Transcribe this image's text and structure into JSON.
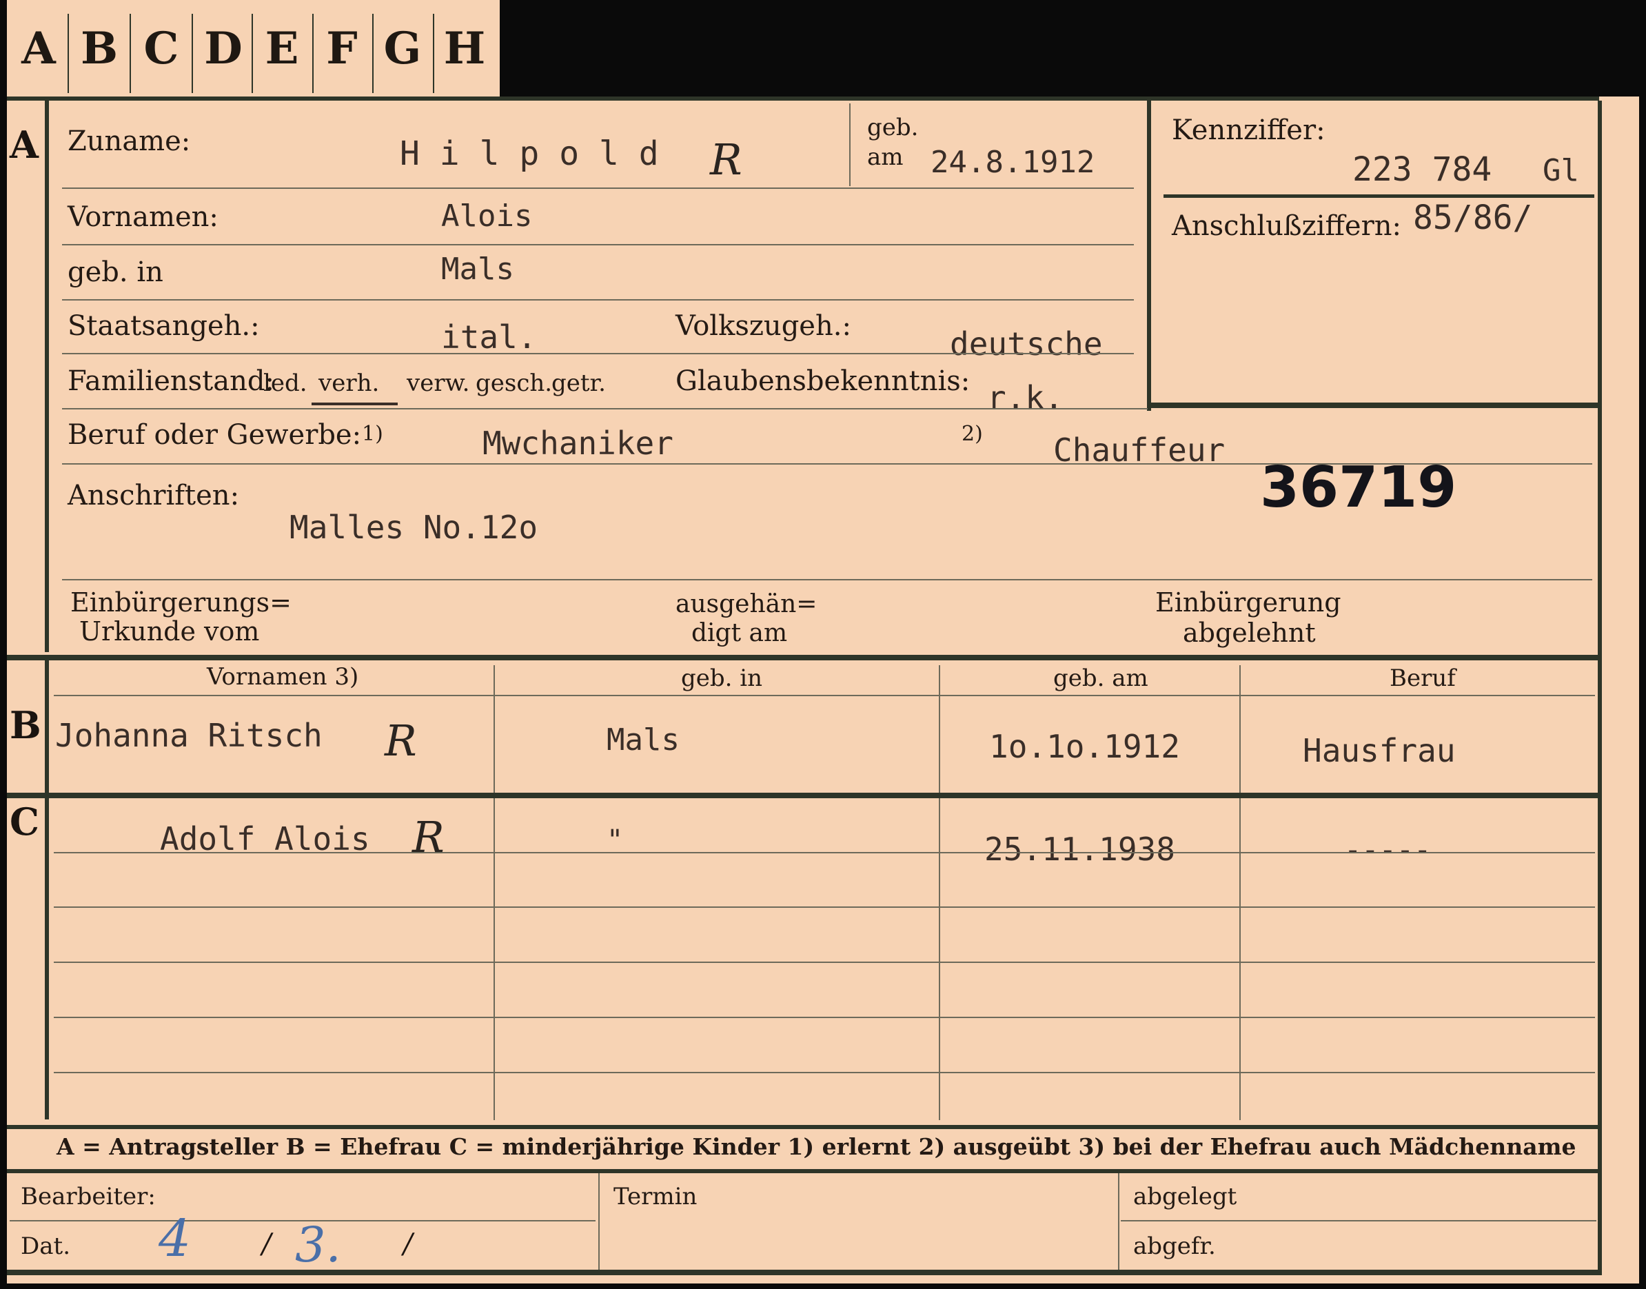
{
  "tabs": [
    "A",
    "B",
    "C",
    "D",
    "E",
    "F",
    "G",
    "H"
  ],
  "sections": {
    "a": "A",
    "b": "B",
    "c": "C"
  },
  "applicant": {
    "surname_label": "Zuname:",
    "surname": "H i l p o l d",
    "geb_label": "geb.",
    "am_label": "am",
    "birth_date": "24.8.1912",
    "first_names_label": "Vornamen:",
    "first_names": "Alois",
    "birthplace_label": "geb. in",
    "birthplace": "Mals",
    "citizenship_label": "Staatsangeh.:",
    "citizenship": "ital.",
    "ethnicity_label": "Volkszugeh.:",
    "ethnicity": "deutsche",
    "marital_label": "Familienstand:",
    "marital_options": [
      "led.",
      "verh.",
      "verw.",
      "gesch.",
      "getr."
    ],
    "religion_label": "Glaubensbekenntnis:",
    "religion": "r.k.",
    "profession_label": "Beruf oder Gewerbe:",
    "fn1": "1)",
    "fn2": "2)",
    "profession_learned": "Mwchaniker",
    "profession_practiced": "Chauffeur",
    "address_label": "Anschriften:",
    "address": "Malles No.12o",
    "stamp_number": "36719",
    "naturalization_label_1": "Einbürgerungs=",
    "naturalization_label_2": "Urkunde vom",
    "handed_label_1": "ausgehän=",
    "handed_label_2": "digt am",
    "rejected_label_1": "Einbürgerung",
    "rejected_label_2": "abgelehnt"
  },
  "id_box": {
    "label": "Kennziffer:",
    "number": "223 784",
    "suffix": "Gl",
    "linked_label": "Anschlußziffern:",
    "linked": "85/86/"
  },
  "family_table": {
    "headers": [
      "Vornamen 3)",
      "geb. in",
      "geb. am",
      "Beruf"
    ],
    "spouse": {
      "name": "Johanna Ritsch",
      "birthplace": "Mals",
      "birth_date": "1o.1o.1912",
      "profession": "Hausfrau"
    },
    "child": {
      "name": "Adolf Alois",
      "birthplace": "\"",
      "birth_date": "25.11.1938",
      "profession": "-----"
    }
  },
  "mark_R": "R",
  "legend": "A = Antragsteller   B = Ehefrau   C = minderjährige Kinder   1) erlernt   2) ausgeübt   3) bei der Ehefrau auch Mädchenname",
  "footer": {
    "clerk_label": "Bearbeiter:",
    "date_label": "Dat.",
    "date_day": "4",
    "date_sep1": "/",
    "date_month": "3.",
    "date_sep2": "/",
    "deadline_label": "Termin",
    "filed_label": "abgelegt",
    "retrieved_label": "abgefr."
  },
  "colors": {
    "paper": "#f7d3b4",
    "border": "#2e3528",
    "background": "#0a0a0a",
    "ink_blue": "#4a6fa8"
  }
}
